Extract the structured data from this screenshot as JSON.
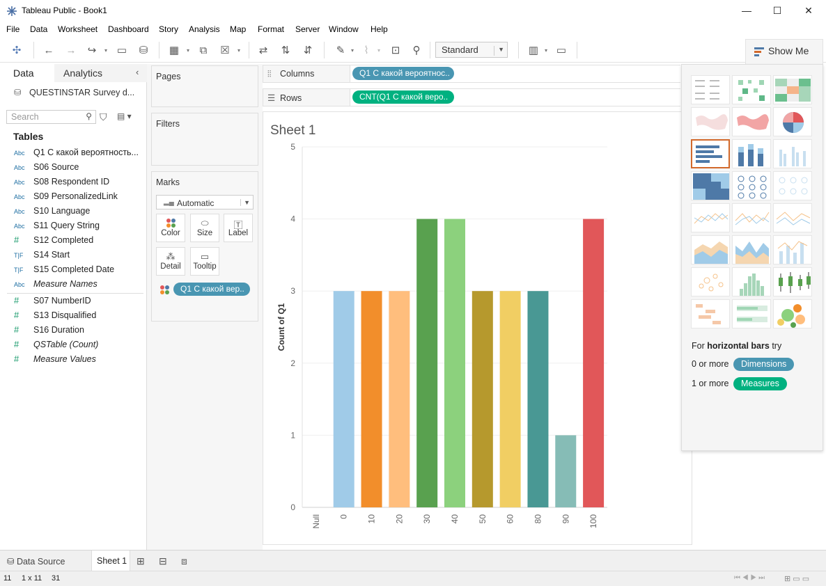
{
  "window": {
    "title": "Tableau Public - Book1",
    "minimize_glyph": "—",
    "maximize_glyph": "☐",
    "close_glyph": "✕"
  },
  "menu": [
    "File",
    "Data",
    "Worksheet",
    "Dashboard",
    "Story",
    "Analysis",
    "Map",
    "Format",
    "Server",
    "Window",
    "Help"
  ],
  "toolbar": {
    "fit_value": "Standard",
    "show_me_label": "Show Me"
  },
  "data_pane": {
    "tab_data": "Data",
    "tab_analytics": "Analytics",
    "datasource_name": "QUESTINSTAR Survey d...",
    "search_placeholder": "Search",
    "tables_heading": "Tables",
    "fields": [
      {
        "type": "Abc",
        "name": "Q1 С какой вероятность...",
        "italic": false
      },
      {
        "type": "Abc",
        "name": "S06 Source",
        "italic": false
      },
      {
        "type": "Abc",
        "name": "S08 Respondent ID",
        "italic": false
      },
      {
        "type": "Abc",
        "name": "S09 PersonalizedLink",
        "italic": false
      },
      {
        "type": "Abc",
        "name": "S10 Language",
        "italic": false
      },
      {
        "type": "Abc",
        "name": "S11 Query String",
        "italic": false
      },
      {
        "type": "#",
        "name": "S12 Completed",
        "italic": false
      },
      {
        "type": "T|F",
        "name": "S14 Start",
        "italic": false
      },
      {
        "type": "T|F",
        "name": "S15 Completed Date",
        "italic": false
      },
      {
        "type": "Abc",
        "name": "Measure Names",
        "italic": true
      }
    ],
    "measures": [
      {
        "type": "#",
        "name": "S07 NumberID",
        "italic": false
      },
      {
        "type": "#",
        "name": "S13 Disqualified",
        "italic": false
      },
      {
        "type": "#",
        "name": "S16 Duration",
        "italic": false
      },
      {
        "type": "#",
        "name": "QSTable (Count)",
        "italic": true
      },
      {
        "type": "#",
        "name": "Measure Values",
        "italic": true
      }
    ]
  },
  "cards": {
    "pages": "Pages",
    "filters": "Filters",
    "marks": "Marks",
    "mark_type": "Automatic",
    "mark_buttons": [
      "Color",
      "Size",
      "Label",
      "Detail",
      "Tooltip"
    ],
    "color_pill": "Q1 С какой вер.."
  },
  "shelves": {
    "columns_label": "Columns",
    "rows_label": "Rows",
    "columns_pill": "Q1 С какой вероятнос..",
    "rows_pill": "CNT(Q1 С какой веро.."
  },
  "sheet": {
    "title": "Sheet 1"
  },
  "chart_data": {
    "type": "bar",
    "categories": [
      "Null",
      "0",
      "10",
      "20",
      "30",
      "40",
      "50",
      "60",
      "80",
      "90",
      "100"
    ],
    "values": [
      0,
      3,
      3,
      3,
      4,
      4,
      3,
      3,
      3,
      1,
      4
    ],
    "colors": [
      "#a0cbe8",
      "#a0cbe8",
      "#f28e2b",
      "#ffbe7d",
      "#59a14f",
      "#8cd17d",
      "#b6992d",
      "#f1ce63",
      "#499894",
      "#86bcb6",
      "#e15759"
    ],
    "title": "",
    "xlabel": "",
    "ylabel": "Count of Q1",
    "ylim": [
      0,
      5
    ],
    "yticks": [
      0,
      1,
      2,
      3,
      4,
      5
    ],
    "grid": true
  },
  "show_me": {
    "hint_prefix": "For",
    "hint_bold": "horizontal bars",
    "hint_suffix": "try",
    "dim_text": "0 or more",
    "dim_pill": "Dimensions",
    "meas_text": "1 or more",
    "meas_pill": "Measures"
  },
  "bottom_tabs": {
    "data_source": "Data Source",
    "sheet": "Sheet 1"
  },
  "status": {
    "marks": "11",
    "dims": "1 x 11",
    "sum": "31"
  }
}
